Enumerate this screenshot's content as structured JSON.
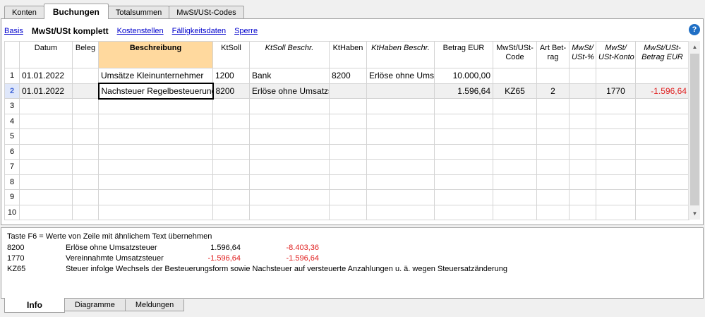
{
  "top_tabs": [
    "Konten",
    "Buchungen",
    "Totalsummen",
    "MwSt/USt-Codes"
  ],
  "views": {
    "basis": "Basis",
    "current": "MwSt/USt komplett",
    "kostenstellen": "Kostenstellen",
    "faelligkeit": "Fälligkeitsdaten",
    "sperre": "Sperre"
  },
  "help_label": "?",
  "columns": [
    {
      "label": "Datum",
      "l2": "",
      "italic": false
    },
    {
      "label": "Beleg",
      "l2": "",
      "italic": false
    },
    {
      "label": "Beschreibung",
      "l2": "",
      "italic": false
    },
    {
      "label": "KtSoll",
      "l2": "",
      "italic": false
    },
    {
      "label": "KtSoll Beschr.",
      "l2": "",
      "italic": true
    },
    {
      "label": "KtHaben",
      "l2": "",
      "italic": false
    },
    {
      "label": "KtHaben Beschr.",
      "l2": "",
      "italic": true
    },
    {
      "label": "Betrag EUR",
      "l2": "",
      "italic": false
    },
    {
      "label": "MwSt/USt-",
      "l2": "Code",
      "italic": false
    },
    {
      "label": "Art Bet-",
      "l2": "rag",
      "italic": false
    },
    {
      "label": "MwSt/",
      "l2": "USt-%",
      "italic": true
    },
    {
      "label": "MwSt/",
      "l2": "USt-Konto",
      "italic": true
    },
    {
      "label": "MwSt/USt-",
      "l2": "Betrag EUR",
      "italic": true
    }
  ],
  "rows": [
    {
      "num": "1",
      "cells": [
        "01.01.2022",
        "",
        "Umsätze Kleinunternehmer",
        "1200",
        "Bank",
        "8200",
        "Erlöse ohne Umsatzsteuer",
        "10.000,00",
        "",
        "",
        "",
        "",
        ""
      ]
    },
    {
      "num": "2",
      "cells": [
        "01.01.2022",
        "",
        "Nachsteuer Regelbesteuerung",
        "8200",
        "Erlöse ohne Umsatzsteuer",
        "",
        "",
        "1.596,64",
        "KZ65",
        "2",
        "",
        "1770",
        "-1.596,64"
      ]
    },
    {
      "num": "3",
      "cells": [
        "",
        "",
        "",
        "",
        "",
        "",
        "",
        "",
        "",
        "",
        "",
        "",
        ""
      ]
    },
    {
      "num": "4",
      "cells": [
        "",
        "",
        "",
        "",
        "",
        "",
        "",
        "",
        "",
        "",
        "",
        "",
        ""
      ]
    },
    {
      "num": "5",
      "cells": [
        "",
        "",
        "",
        "",
        "",
        "",
        "",
        "",
        "",
        "",
        "",
        "",
        ""
      ]
    },
    {
      "num": "6",
      "cells": [
        "",
        "",
        "",
        "",
        "",
        "",
        "",
        "",
        "",
        "",
        "",
        "",
        ""
      ]
    },
    {
      "num": "7",
      "cells": [
        "",
        "",
        "",
        "",
        "",
        "",
        "",
        "",
        "",
        "",
        "",
        "",
        ""
      ]
    },
    {
      "num": "8",
      "cells": [
        "",
        "",
        "",
        "",
        "",
        "",
        "",
        "",
        "",
        "",
        "",
        "",
        ""
      ]
    },
    {
      "num": "9",
      "cells": [
        "",
        "",
        "",
        "",
        "",
        "",
        "",
        "",
        "",
        "",
        "",
        "",
        ""
      ]
    },
    {
      "num": "10",
      "cells": [
        "",
        "",
        "",
        "",
        "",
        "",
        "",
        "",
        "",
        "",
        "",
        "",
        ""
      ]
    }
  ],
  "info": {
    "hint": "Taste F6 = Werte von Zeile mit ähnlichem Text übernehmen",
    "lines": [
      {
        "code": "8200",
        "desc": "Erlöse ohne Umsatzsteuer",
        "v1": "1.596,64",
        "v2": "-8.403,36"
      },
      {
        "code": "1770",
        "desc": "Vereinnahmte Umsatzsteuer",
        "v1": "-1.596,64",
        "v2": "-1.596,64"
      }
    ],
    "kz_code": "KZ65",
    "kz_desc": "Steuer infolge Wechsels der Besteuerungsform sowie Nachsteuer auf versteuerte Anzahlungen u. ä. wegen Steuersatzänderung"
  },
  "bottom_tabs": [
    "Info",
    "Diagramme",
    "Meldungen"
  ],
  "colors": {
    "negative": "#e02020",
    "header_selected": "#ffd99e",
    "link": "#0000cc"
  }
}
